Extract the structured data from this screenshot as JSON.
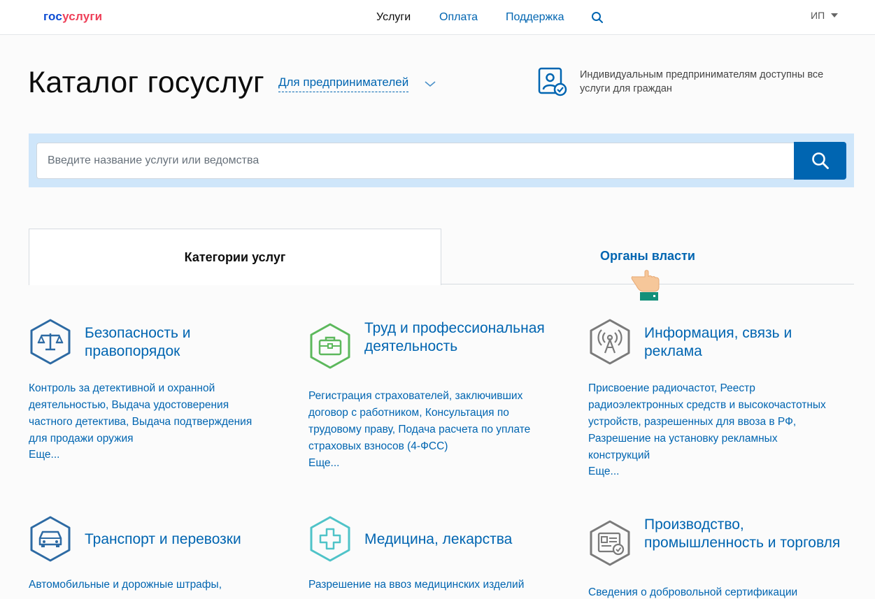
{
  "header": {
    "logo_part1": "гос",
    "logo_part2": "услуги",
    "nav": [
      {
        "label": "Услуги"
      },
      {
        "label": "Оплата"
      },
      {
        "label": "Поддержка"
      }
    ],
    "user_label": "ИП"
  },
  "page": {
    "title": "Каталог госуслуг",
    "audience_selector": "Для предпринимателей",
    "info_text": "Индивидуальным предпринимателям доступны все услуги для граждан"
  },
  "search": {
    "placeholder": "Введите название услуги или ведомства"
  },
  "tabs": [
    {
      "label": "Категории услуг",
      "active": true
    },
    {
      "label": "Органы власти",
      "active": false
    }
  ],
  "categories": [
    {
      "title": "Безопасность и правопорядок",
      "description": "Контроль за детективной и охранной деятельностью, Выдача удостоверения частного детектива, Выдача подтверждения для продажи оружия",
      "more": "Еще...",
      "icon": "scales-icon",
      "color": "#2d6aa3"
    },
    {
      "title": "Труд и профессиональная деятельность",
      "description": "Регистрация страхователей, заключивших договор с работником, Консультация по трудовому праву, Подача расчета по уплате страховых взносов (4-ФСС)",
      "more": "Еще...",
      "icon": "briefcase-icon",
      "color": "#5cb85c"
    },
    {
      "title": "Информация, связь и реклама",
      "description": "Присвоение радиочастот, Реестр радиоэлектронных средств и высокочастотных устройств, разрешенных для ввоза в РФ, Разрешение на установку рекламных конструкций",
      "more": "Еще...",
      "icon": "antenna-icon",
      "color": "#7a7a7a"
    },
    {
      "title": "Транспорт и перевозки",
      "description": "Автомобильные и дорожные штрафы,",
      "icon": "car-icon",
      "color": "#2d6aa3"
    },
    {
      "title": "Медицина, лекарства",
      "description": "Разрешение на ввоз медицинских изделий",
      "icon": "medical-cross-icon",
      "color": "#4fc3c8"
    },
    {
      "title": "Производство, промышленность и торговля",
      "description": "Сведения о добровольной сертификации",
      "icon": "certificate-icon",
      "color": "#7a7a7a"
    }
  ],
  "colors": {
    "accent": "#0065b1",
    "search_band": "#cfe6fa",
    "logo_blue": "#0d4cd3",
    "logo_red": "#ee3f58"
  }
}
